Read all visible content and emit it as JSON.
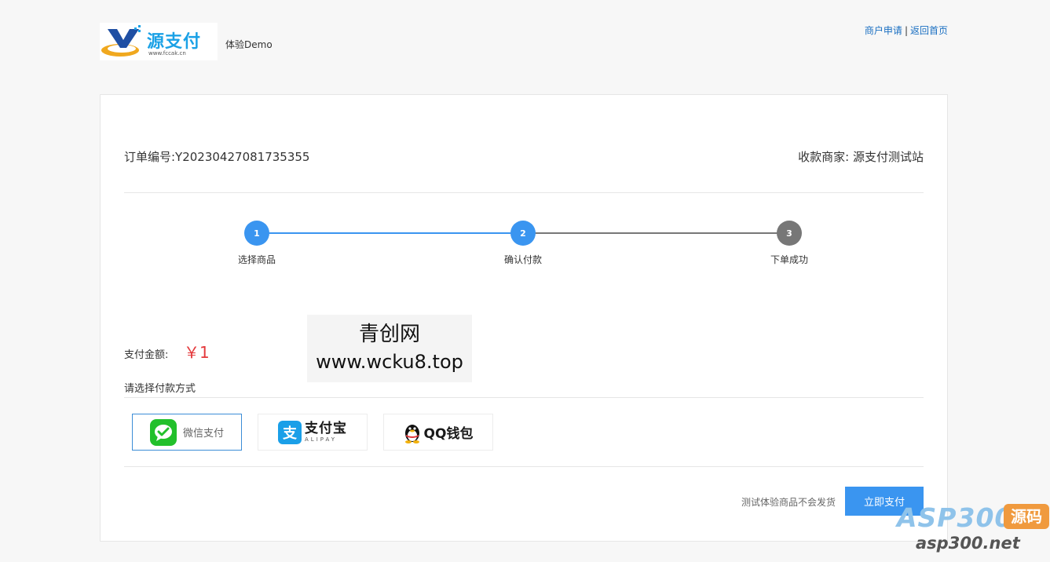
{
  "header": {
    "logo": {
      "title": "源支付",
      "url": "www.fccak.cn"
    },
    "demo_text": "体验Demo",
    "links": {
      "apply": "商户申请",
      "separator": "|",
      "home": "返回首页"
    }
  },
  "order": {
    "order_no": "订单编号:Y20230427081735355",
    "merchant": "收款商家: 源支付测试站"
  },
  "steps": [
    {
      "number": "1",
      "label": "选择商品",
      "state": "done"
    },
    {
      "number": "2",
      "label": "确认付款",
      "state": "current"
    },
    {
      "number": "3",
      "label": "下单成功",
      "state": "pending"
    }
  ],
  "payment": {
    "amount_label": "支付金额:",
    "amount_value": "￥1",
    "choose_label": "请选择付款方式",
    "methods": [
      {
        "id": "wechat",
        "label": "微信支付",
        "icon": "wechat-icon",
        "selected": true
      },
      {
        "id": "alipay",
        "label": "支付宝",
        "sublabel": "ALIPAY",
        "icon": "alipay-icon",
        "selected": false
      },
      {
        "id": "qq",
        "label": "QQ钱包",
        "icon": "qq-penguin-icon",
        "selected": false
      }
    ]
  },
  "footer": {
    "notice": "测试体验商品不会发货",
    "pay_button": "立即支付"
  },
  "watermark_center": {
    "line1": "青创网",
    "line2": "www.wcku8.top"
  },
  "watermark_corner": {
    "brand": "ASP300",
    "tag": "源码",
    "url": "asp300.net"
  },
  "colors": {
    "accent": "#3a95f0",
    "step_active": "#3a95f0",
    "step_pending": "#777777",
    "price": "#e4393c",
    "link": "#1a6fc2"
  }
}
